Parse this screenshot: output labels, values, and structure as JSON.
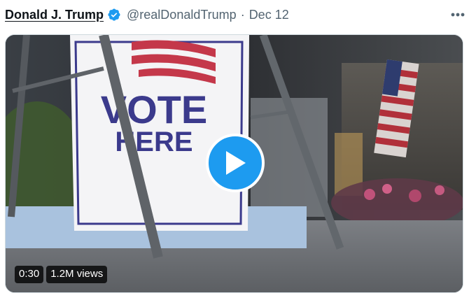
{
  "tweet": {
    "author_name": "Donald J. Trump",
    "handle": "@realDonaldTrump",
    "separator": "·",
    "date": "Dec 12",
    "verified_icon": "verified-badge-icon",
    "more_icon": "more-horizontal-icon"
  },
  "video": {
    "sign_line1": "VOTE",
    "sign_line2": "HERE",
    "duration": "0:30",
    "views": "1.2M views",
    "play_icon": "play-icon"
  },
  "colors": {
    "accent": "#1d9bf0",
    "secondary_text": "#536471",
    "sign_text": "#3b3a8c"
  }
}
